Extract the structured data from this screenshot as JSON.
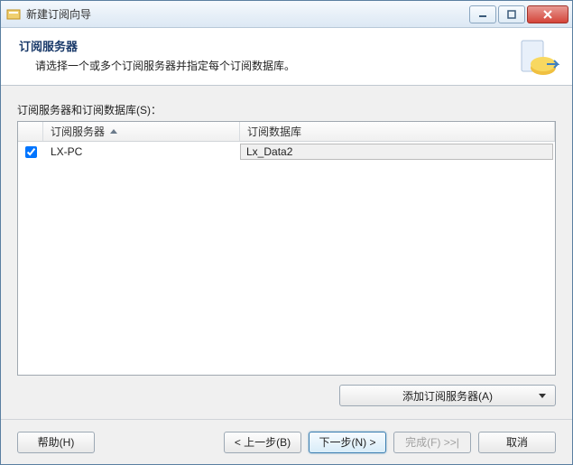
{
  "window": {
    "title": "新建订阅向导"
  },
  "header": {
    "title": "订阅服务器",
    "subtitle": "请选择一个或多个订阅服务器并指定每个订阅数据库。"
  },
  "section": {
    "label": "订阅服务器和订阅数据库(S)："
  },
  "table": {
    "columns": {
      "server": "订阅服务器",
      "database": "订阅数据库"
    },
    "rows": [
      {
        "checked": true,
        "server": "LX-PC",
        "database": "Lx_Data2"
      }
    ]
  },
  "dropdown": {
    "label": "添加订阅服务器(A)"
  },
  "footer": {
    "help": "帮助(H)",
    "back": "< 上一步(B)",
    "next": "下一步(N) >",
    "finish": "完成(F) >>|",
    "cancel": "取消"
  }
}
